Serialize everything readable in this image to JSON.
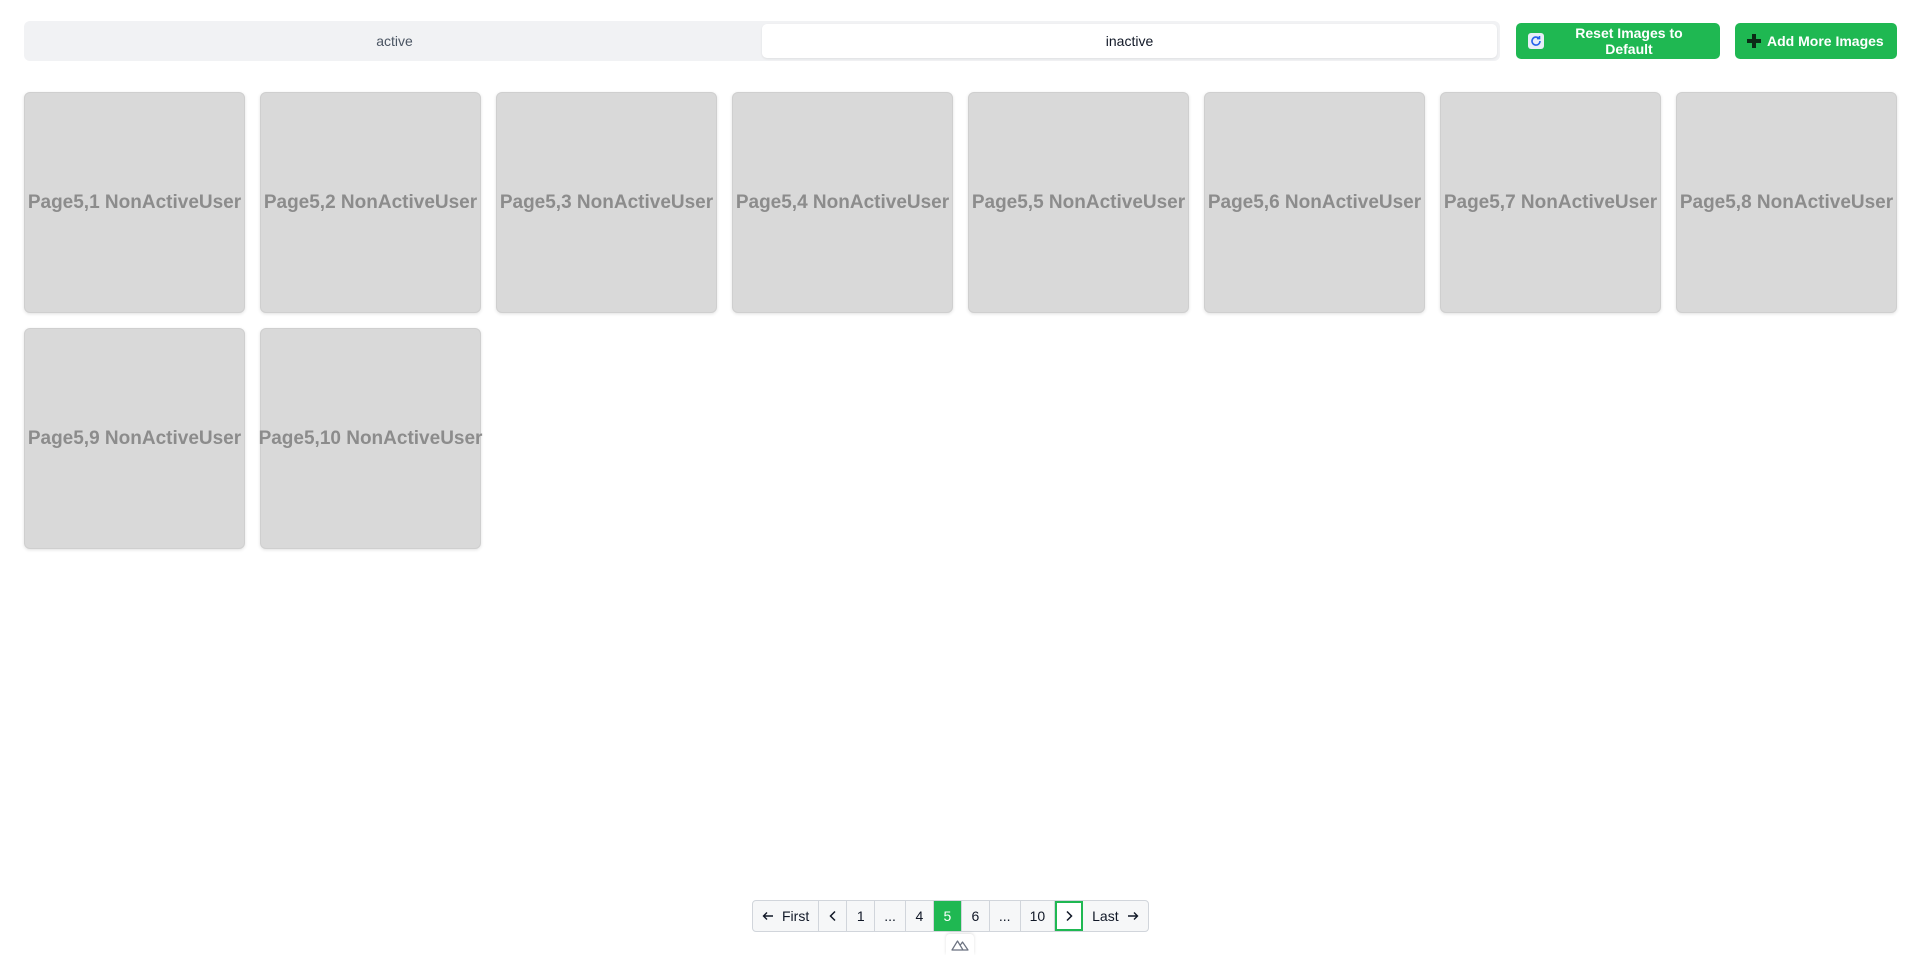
{
  "tabs": [
    {
      "label": "active",
      "selected": false
    },
    {
      "label": "inactive",
      "selected": true
    }
  ],
  "buttons": {
    "reset_label": "Reset Images to Default",
    "add_label": "Add More Images"
  },
  "cards": [
    "Page5,1 NonActiveUser",
    "Page5,2 NonActiveUser",
    "Page5,3 NonActiveUser",
    "Page5,4 NonActiveUser",
    "Page5,5 NonActiveUser",
    "Page5,6 NonActiveUser",
    "Page5,7 NonActiveUser",
    "Page5,8 NonActiveUser",
    "Page5,9 NonActiveUser",
    "Page5,10 NonActiveUser"
  ],
  "pagination": {
    "first_label": "First",
    "last_label": "Last",
    "pages": [
      "1",
      "...",
      "4",
      "5",
      "6",
      "...",
      "10"
    ],
    "current_page": "5"
  },
  "colors": {
    "accent": "#1fb852",
    "card_bg": "#d9d9d9",
    "card_text": "#8c8c8c"
  },
  "icons": {
    "reset": "refresh-icon",
    "add": "plus-icon",
    "first": "arrow-left-icon",
    "prev": "chevron-left-icon",
    "next": "chevron-right-icon",
    "last": "arrow-right-icon",
    "badge": "mountain-logo-icon"
  }
}
